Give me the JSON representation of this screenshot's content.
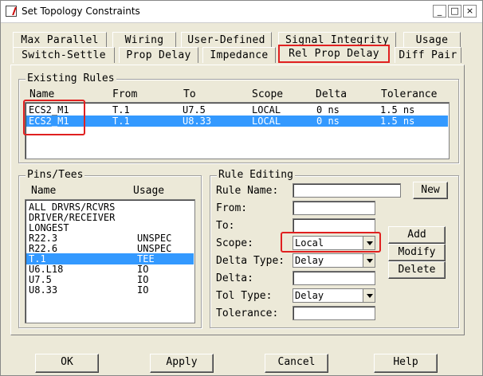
{
  "window": {
    "title": "Set Topology Constraints",
    "min": "_",
    "max": "□",
    "close": "×"
  },
  "tabs_row1": [
    "Max Parallel",
    "Wiring",
    "User-Defined",
    "Signal Integrity",
    "Usage"
  ],
  "tabs_row2": [
    "Switch-Settle",
    "Prop Delay",
    "Impedance",
    "Rel Prop Delay",
    "Diff Pair"
  ],
  "active_tab": "Rel Prop Delay",
  "existing_rules": {
    "label": "Existing Rules",
    "columns": [
      "Name",
      "From",
      "To",
      "Scope",
      "Delta",
      "Tolerance"
    ],
    "rows": [
      {
        "name": "ECS2_M1",
        "from": "T.1",
        "to": "U7.5",
        "scope": "LOCAL",
        "delta": "0 ns",
        "tolerance": "1.5 ns",
        "selected": false
      },
      {
        "name": "ECS2_M1",
        "from": "T.1",
        "to": "U8.33",
        "scope": "LOCAL",
        "delta": "0 ns",
        "tolerance": "1.5 ns",
        "selected": true
      }
    ]
  },
  "pins": {
    "label": "Pins/Tees",
    "columns": [
      "Name",
      "Usage"
    ],
    "rows": [
      {
        "name": "ALL DRVRS/RCVRS",
        "usage": ""
      },
      {
        "name": "DRIVER/RECEIVER",
        "usage": ""
      },
      {
        "name": "LONGEST",
        "usage": ""
      },
      {
        "name": "R22.3",
        "usage": "UNSPEC"
      },
      {
        "name": "R22.6",
        "usage": "UNSPEC"
      },
      {
        "name": "T.1",
        "usage": "TEE",
        "selected": true
      },
      {
        "name": "U6.L18",
        "usage": "IO"
      },
      {
        "name": "U7.5",
        "usage": "IO"
      },
      {
        "name": "U8.33",
        "usage": "IO"
      }
    ]
  },
  "rule_editing": {
    "label": "Rule Editing",
    "rule_name_label": "Rule Name:",
    "rule_name_value": "",
    "new_button": "New",
    "from_label": "From:",
    "from_value": "",
    "to_label": "To:",
    "to_value": "",
    "scope_label": "Scope:",
    "scope_value": "Local",
    "delta_type_label": "Delta Type:",
    "delta_type_value": "Delay",
    "delta_label": "Delta:",
    "delta_value": "",
    "tol_type_label": "Tol Type:",
    "tol_type_value": "Delay",
    "tolerance_label": "Tolerance:",
    "tolerance_value": "",
    "add_button": "Add",
    "modify_button": "Modify",
    "delete_button": "Delete"
  },
  "footer": {
    "ok": "OK",
    "apply": "Apply",
    "cancel": "Cancel",
    "help": "Help"
  },
  "colors": {
    "selection": "#3399ff",
    "highlight_box": "#e02020",
    "dialog_bg": "#ece9d8"
  }
}
